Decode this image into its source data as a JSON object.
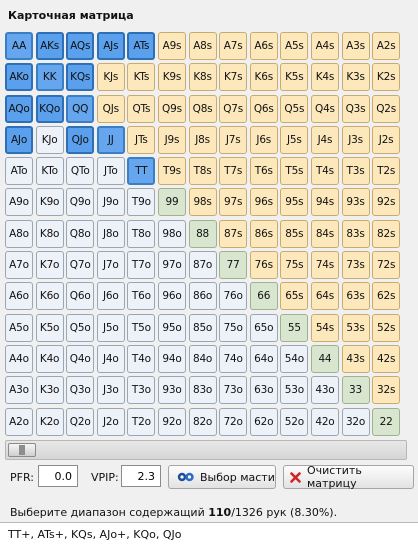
{
  "title": "Карточная матрица",
  "ranks": [
    "A",
    "K",
    "Q",
    "J",
    "T",
    "9",
    "8",
    "7",
    "6",
    "5",
    "4",
    "3",
    "2"
  ],
  "selected_hands": [
    "AA",
    "AKs",
    "AQs",
    "AJs",
    "ATs",
    "AKo",
    "KK",
    "KQs",
    "AQo",
    "KQo",
    "QQ",
    "AJo",
    "QJo",
    "JJ",
    "TT"
  ],
  "slider": {
    "value_fraction": 0.0
  },
  "pfr": {
    "label": "PFR:",
    "value": "0.0"
  },
  "vpip": {
    "label": "VPIP:",
    "value": "2.3"
  },
  "buttons": {
    "suit_select": "Выбор масти",
    "clear_matrix": "Очистить матрицу"
  },
  "info": {
    "prefix": "Выберите диапазон содержащий ",
    "selected_combos": "110",
    "total_combos": "/1326",
    "suffix": " рук (8.30%)."
  },
  "range_text": "TT+, ATs+, KQs, AJo+, KQo, QJo",
  "colors": {
    "suited": "#fde8bc",
    "offsuit": "#edf2f8",
    "pair": "#d9e6cf",
    "selected": "#5aa0ec"
  }
}
